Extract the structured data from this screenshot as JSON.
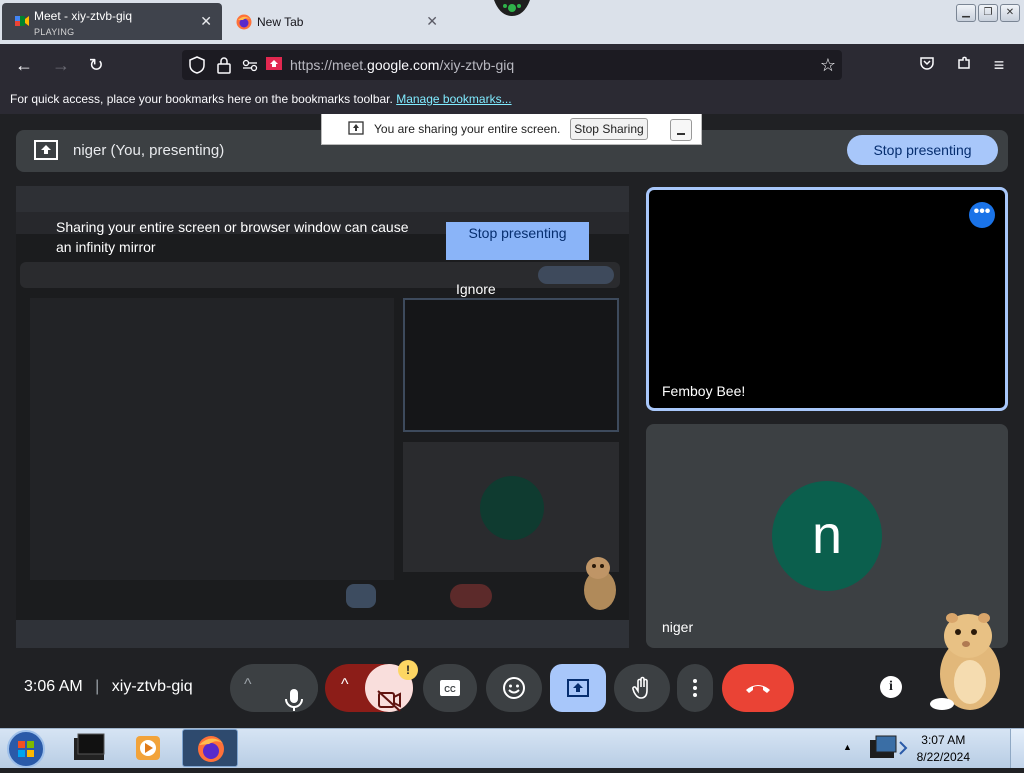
{
  "browser": {
    "tabs": [
      {
        "title": "Meet - xiy-ztvb-giq",
        "status": "PLAYING",
        "active": true
      },
      {
        "title": "New Tab",
        "active": false
      }
    ],
    "url_prefix": "https://meet.",
    "url_domain": "google.com",
    "url_path": "/xiy-ztvb-giq",
    "bookmarks_hint": "For quick access, place your bookmarks here on the bookmarks toolbar.",
    "bookmarks_link": "Manage bookmarks..."
  },
  "share_notice": {
    "text": "You are sharing your entire screen.",
    "stop_label": "Stop Sharing"
  },
  "meet": {
    "presenting_label": "niger (You, presenting)",
    "stop_presenting_label": "Stop presenting",
    "warning_text": "Sharing your entire screen or browser window can cause an infinity mirror",
    "warning_stop_label": "Stop presenting",
    "ignore_label": "Ignore",
    "tiles": [
      {
        "name": "Femboy Bee!"
      },
      {
        "name": "niger",
        "initial": "n"
      }
    ],
    "time": "3:06 AM",
    "meeting_code": "xiy-ztvb-giq",
    "alert_badge": "!"
  },
  "taskbar": {
    "time": "3:07 AM",
    "date": "8/22/2024"
  },
  "colors": {
    "meet_bg": "#202124",
    "accent_blue": "#a8c7fa",
    "end_call_red": "#ea4335",
    "cam_off_red": "#8c1d18"
  }
}
